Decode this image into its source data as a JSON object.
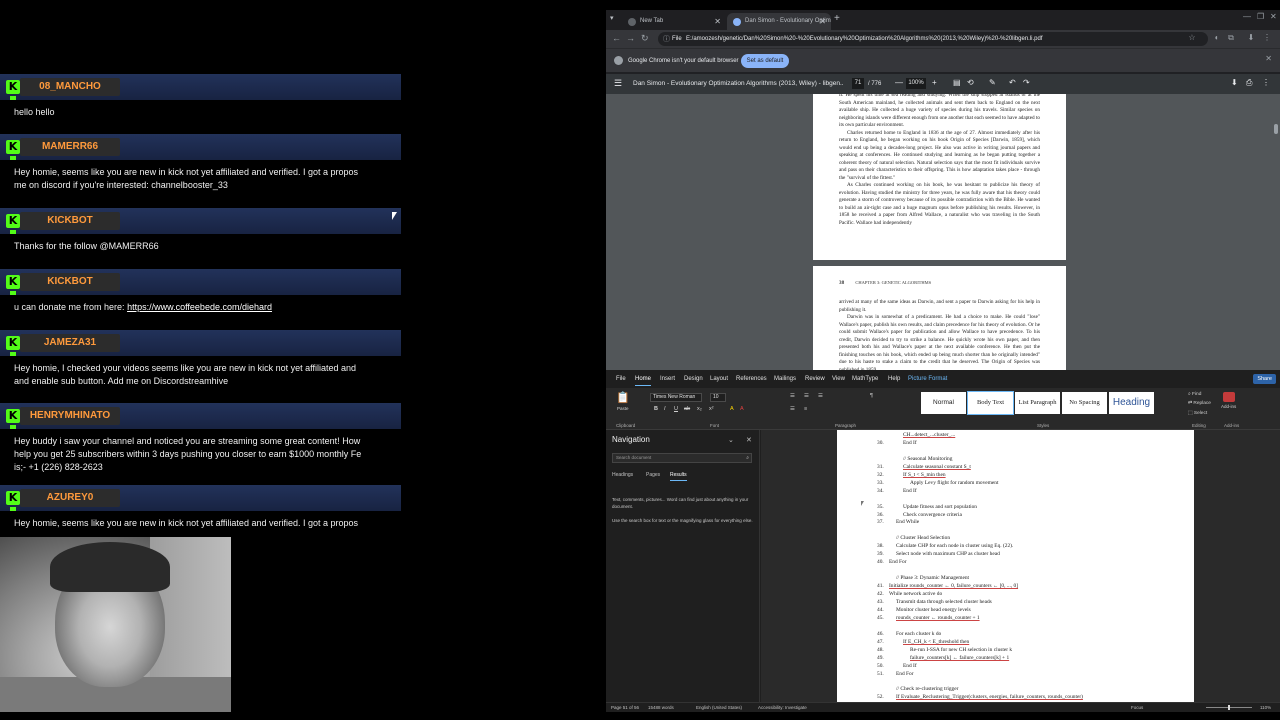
{
  "chat": {
    "messages": [
      {
        "user": "08_MANCHO",
        "text": "hello hello",
        "link": ""
      },
      {
        "user": "MAMERR66",
        "text": "Hey homie, seems like you are new in kick not yet affiliated and verified. I got a propos\nme on discord if you're interested: channelbooster_33",
        "link": ""
      },
      {
        "user": "KICKBOT",
        "text": "Thanks for the follow @MAMERR66",
        "link": ""
      },
      {
        "user": "KICKBOT",
        "text": "u can donate me from here: ",
        "link": "https://www.coffeebede.com/diehard"
      },
      {
        "user": "JAMEZA31",
        "text": "Hey homie, I checked your videos seems like you are new in kick not yet affiliated and\nand enable sub button. Add me on Discordstreamhive",
        "link": ""
      },
      {
        "user": "HENRYMHINATO",
        "text": "Hey buddy i saw your channel and noticed you are streaming some great content! How\nhelp you get 25 subscribers within 3 days pushing you closer to earn $1000 monthly Fe\nis;- +1 (226) 828-2623",
        "link": ""
      },
      {
        "user": "AZUREY0",
        "text": "Hey homie, seems like you are new in kick not yet affiliated and verified. I got a propos",
        "link": ""
      }
    ],
    "badge_glyph": "K",
    "accent_color": "#53fc18",
    "username_color": "#ff9a3c"
  },
  "chrome": {
    "tabs": [
      {
        "title": "New Tab",
        "close": "✕"
      },
      {
        "title": "Dan Simon - Evolutionary Optim",
        "close": "✕"
      }
    ],
    "tab_list_icon": "▾",
    "new_tab": "+",
    "window_controls": [
      "—",
      "❐",
      "✕"
    ],
    "nav": {
      "back": "←",
      "forward": "→",
      "reload": "↻"
    },
    "address": {
      "scheme_label": "File",
      "url": "E:/amoozesh/genetic/Dan%20Simon%20-%20Evolutionary%20Optimization%20Algorithms%20(2013,%20Wiley)%20-%20libgen.li.pdf"
    },
    "toolbar_icons": [
      "☆",
      "◐",
      "⧉",
      "⬇",
      "⋮"
    ],
    "infobar": {
      "text": "Google Chrome isn't your default browser",
      "button": "Set as default",
      "close": "✕"
    },
    "pdf": {
      "menu_icon": "☰",
      "title": "Dan Simon - Evolutionary Optimization Algorithms (2013, Wiley) - libgen...",
      "page_current": "71",
      "page_total": "/ 776",
      "zoom": "100%",
      "zoom_out": "—",
      "zoom_in": "+",
      "tool_icons": [
        "▤",
        "⟲",
        "✎",
        "↶",
        "↷",
        "⬇",
        "⎙",
        "⋮"
      ],
      "page1_paragraphs": [
        "It. He spent his time at sea reading and studying. When the ship stopped at islands or at the South American mainland, he collected animals and sent them back to England on the next available ship. He collected a huge variety of species during his travels. Similar species on neighboring islands were different enough from one another that each seemed to have adapted to its own particular environment.",
        "Charles returned home to England in 1836 at the age of 27. Almost immediately after his return to England, he began working on his book Origin of Species [Darwin, 1859], which would end up being a decades-long project. He also was active in writing journal papers and speaking at conferences. He continued studying and learning as he began putting together a coherent theory of natural selection. Natural selection says that the most fit individuals survive and pass on their characteristics to their offspring. This is how adaptation takes place - through the \"survival of the fittest.\"",
        "As Charles continued working on his book, he was hesitant to publicize his theory of evolution. Having studied the ministry for three years, he was fully aware that his theory could generate a storm of controversy because of its possible contradiction with the Bible. He wanted to build an air-tight case and a huge magnum opus before publishing his results. However, in 1858 he received a paper from Alfred Wallace, a naturalist who was traveling in the South Pacific. Wallace had independently"
      ],
      "page2_number": "38",
      "page2_header": "CHAPTER 3: GENETIC ALGORITHMS",
      "page2_paragraphs": [
        "arrived at many of the same ideas as Darwin, and sent a paper to Darwin asking for his help in publishing it.",
        "Darwin was in somewhat of a predicament. He had a choice to make. He could \"lose\" Wallace's paper, publish his own results, and claim precedence for his theory of evolution. Or he could submit Wallace's paper for publication and allow Wallace to have precedence. To his credit, Darwin decided to try to strike a balance. He quickly wrote his own paper, and then presented both his and Wallace's paper at the next available conference. He then put the finishing touches on his book, which ended up being much shorter than he originally intended\" due to his haste to stake a claim to the credit that he deserved. The Origin of Species was published in 1859"
      ]
    }
  },
  "word": {
    "tabs": [
      "File",
      "Home",
      "Insert",
      "Design",
      "Layout",
      "References",
      "Mailings",
      "Review",
      "View",
      "MathType",
      "Help",
      "Picture Format"
    ],
    "active_tab": "Home",
    "share": "Share",
    "font_name": "Times New Roman",
    "font_size": "10",
    "styles": [
      "Normal",
      "Body Text",
      "List Paragraph",
      "No Spacing",
      "Heading"
    ],
    "groups": [
      "Clipboard",
      "Font",
      "Paragraph",
      "Styles",
      "Editing",
      "Add-ins"
    ],
    "editing": [
      "Find",
      "Replace",
      "Select"
    ],
    "addins": "Add-ins",
    "paste": "Paste",
    "ribbon_font_glyphs": [
      "B",
      "I",
      "U",
      "ab",
      "x₂",
      "x²",
      "A",
      "A"
    ],
    "ribbon_para_glyphs": [
      "☰",
      "☰",
      "☰",
      "☰",
      "≡",
      "¶"
    ],
    "navigation": {
      "title": "Navigation",
      "search_placeholder": "Search document",
      "search_icon": "⌕",
      "tabs": [
        "Headings",
        "Pages",
        "Results"
      ],
      "active_tab": "Results",
      "hint1": "Text, comments, pictures... Word can find just about anything in your document.",
      "hint2": "Use the search box for text or the magnifying glass for everything else.",
      "collapse": "⌄",
      "close": "✕"
    },
    "doc_lines": [
      {
        "n": "",
        "indent": 2,
        "text": "CH...detect_...cluster_..."
      },
      {
        "n": "30.",
        "indent": 2,
        "text": "End If"
      },
      {
        "n": "",
        "indent": 0,
        "text": ""
      },
      {
        "n": "",
        "indent": 2,
        "text": "// Seasonal Monitoring"
      },
      {
        "n": "31.",
        "indent": 2,
        "text": "Calculate seasonal constant S_t"
      },
      {
        "n": "32.",
        "indent": 2,
        "text": "If S_t < S_min then"
      },
      {
        "n": "33.",
        "indent": 3,
        "text": "Apply Levy flight for random movement"
      },
      {
        "n": "34.",
        "indent": 2,
        "text": "End If"
      },
      {
        "n": "",
        "indent": 0,
        "text": ""
      },
      {
        "n": "35.",
        "indent": 2,
        "text": "Update fitness and sort population"
      },
      {
        "n": "36.",
        "indent": 2,
        "text": "Check convergence criteria"
      },
      {
        "n": "37.",
        "indent": 1,
        "text": "End While"
      },
      {
        "n": "",
        "indent": 0,
        "text": ""
      },
      {
        "n": "",
        "indent": 1,
        "text": "// Cluster Head Selection"
      },
      {
        "n": "38.",
        "indent": 1,
        "text": "Calculate CHP for each node in cluster using Eq. (22)."
      },
      {
        "n": "39.",
        "indent": 1,
        "text": "Select node with maximum CHP as cluster head"
      },
      {
        "n": "40.",
        "indent": 0,
        "text": "End For"
      },
      {
        "n": "",
        "indent": 0,
        "text": ""
      },
      {
        "n": "",
        "indent": 1,
        "text": "// Phase 3: Dynamic Management"
      },
      {
        "n": "41.",
        "indent": 0,
        "text": "Initialize rounds_counter ← 0, failure_counters ← [0, ..., 0]"
      },
      {
        "n": "42.",
        "indent": 0,
        "text": "While network active do"
      },
      {
        "n": "43.",
        "indent": 1,
        "text": "Transmit data through selected cluster heads"
      },
      {
        "n": "44.",
        "indent": 1,
        "text": "Monitor cluster head energy levels"
      },
      {
        "n": "45.",
        "indent": 1,
        "text": "rounds_counter ← rounds_counter + 1"
      },
      {
        "n": "",
        "indent": 0,
        "text": ""
      },
      {
        "n": "46.",
        "indent": 1,
        "text": "For each cluster k do"
      },
      {
        "n": "47.",
        "indent": 2,
        "text": "If E_CH_k < E_threshold then"
      },
      {
        "n": "48.",
        "indent": 3,
        "text": "Re-run I-SSA for new CH selection in cluster k"
      },
      {
        "n": "49.",
        "indent": 3,
        "text": "failure_counters[k] ← failure_counters[k] + 1"
      },
      {
        "n": "50.",
        "indent": 2,
        "text": "End If"
      },
      {
        "n": "51.",
        "indent": 1,
        "text": "End For"
      },
      {
        "n": "",
        "indent": 0,
        "text": ""
      },
      {
        "n": "",
        "indent": 1,
        "text": "// Check re-clustering trigger"
      },
      {
        "n": "52.",
        "indent": 1,
        "text": "If Evaluate_Reclustering_Trigger(clusters, energies, failure_counters, rounds_counter)"
      }
    ],
    "status": {
      "page": "Page 51 of 56",
      "words": "15488 words",
      "language": "English (United States)",
      "accessibility": "Accessibility: Investigate",
      "focus": "Focus",
      "zoom": "110%"
    }
  }
}
